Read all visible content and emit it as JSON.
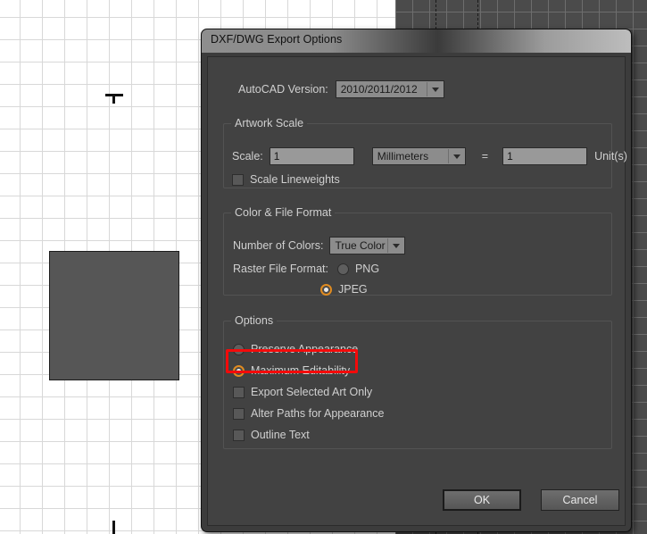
{
  "dialog": {
    "title": "DXF/DWG Export Options",
    "autocad": {
      "label": "AutoCAD Version:",
      "value": "2010/2011/2012",
      "options": [
        "2010/2011/2012"
      ]
    },
    "artwork_scale": {
      "legend": "Artwork Scale",
      "scale_label": "Scale:",
      "scale_value": "1",
      "units_value": "Millimeters",
      "units_options": [
        "Millimeters"
      ],
      "equals": "=",
      "ratio_value": "1",
      "unit_suffix": "Unit(s)",
      "scale_lineweights_label": "Scale Lineweights",
      "scale_lineweights_checked": false
    },
    "color_file_format": {
      "legend": "Color & File Format",
      "colors_label": "Number of Colors:",
      "colors_value": "True Color",
      "colors_options": [
        "True Color"
      ],
      "raster_label": "Raster File Format:",
      "raster_options": [
        {
          "label": "PNG",
          "selected": false
        },
        {
          "label": "JPEG",
          "selected": true
        }
      ]
    },
    "options": {
      "legend": "Options",
      "radios": [
        {
          "label": "Preserve Appearance",
          "selected": false
        },
        {
          "label": "Maximum Editability",
          "selected": true
        }
      ],
      "checkboxes": [
        {
          "label": "Export Selected Art Only",
          "checked": false
        },
        {
          "label": "Alter Paths for Appearance",
          "checked": false
        },
        {
          "label": "Outline Text",
          "checked": false
        }
      ]
    },
    "buttons": {
      "ok": "OK",
      "cancel": "Cancel"
    }
  },
  "highlight": {
    "color": "#f40a0a",
    "target": "Maximum Editability"
  },
  "canvas": {
    "shape": "rectangle"
  }
}
